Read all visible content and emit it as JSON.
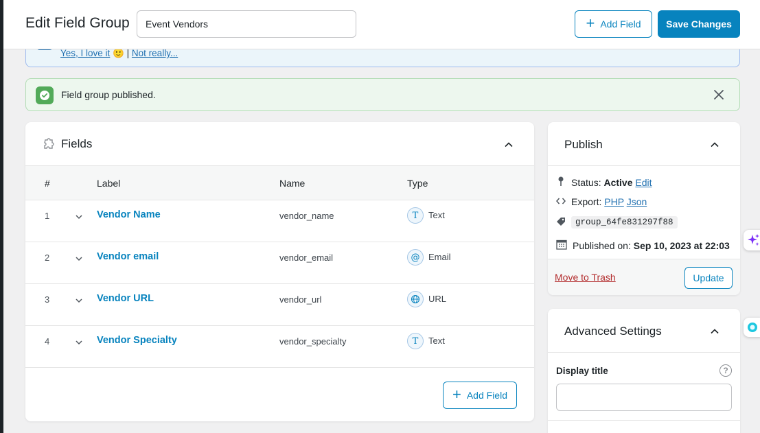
{
  "header": {
    "title": "Edit Field Group",
    "group_title_value": "Event Vendors",
    "add_field_label": "Add Field",
    "save_label": "Save Changes"
  },
  "feedback_notice": {
    "yes_link": "Yes, I love it",
    "emoji": "🙂",
    "separator": "|",
    "no_link": "Not really..."
  },
  "success_notice": {
    "message": "Field group published."
  },
  "fields_panel": {
    "title": "Fields",
    "columns": [
      "#",
      "Label",
      "Name",
      "Type"
    ],
    "rows": [
      {
        "num": "1",
        "label": "Vendor Name",
        "name": "vendor_name",
        "type": "Text",
        "icon": "text-type-icon",
        "glyph": "T"
      },
      {
        "num": "2",
        "label": "Vendor email",
        "name": "vendor_email",
        "type": "Email",
        "icon": "email-type-icon",
        "glyph": "@"
      },
      {
        "num": "3",
        "label": "Vendor URL",
        "name": "vendor_url",
        "type": "URL",
        "icon": "globe-type-icon",
        "glyph": ""
      },
      {
        "num": "4",
        "label": "Vendor Specialty",
        "name": "vendor_specialty",
        "type": "Text",
        "icon": "text-type-icon",
        "glyph": "T"
      }
    ],
    "add_field_label": "Add Field"
  },
  "publish": {
    "title": "Publish",
    "status_label": "Status:",
    "status_value": "Active",
    "status_edit": "Edit",
    "export_label": "Export:",
    "export_php": "PHP",
    "export_json": "Json",
    "group_key": "group_64fe831297f88",
    "published_label": "Published on:",
    "published_value": "Sep 10, 2023 at 22:03",
    "trash_label": "Move to Trash",
    "update_label": "Update"
  },
  "advanced": {
    "title": "Advanced Settings",
    "display_title_label": "Display title",
    "display_title_value": ""
  },
  "colors": {
    "accent": "#0783be",
    "success": "#52aa59",
    "danger": "#b32d2e"
  }
}
